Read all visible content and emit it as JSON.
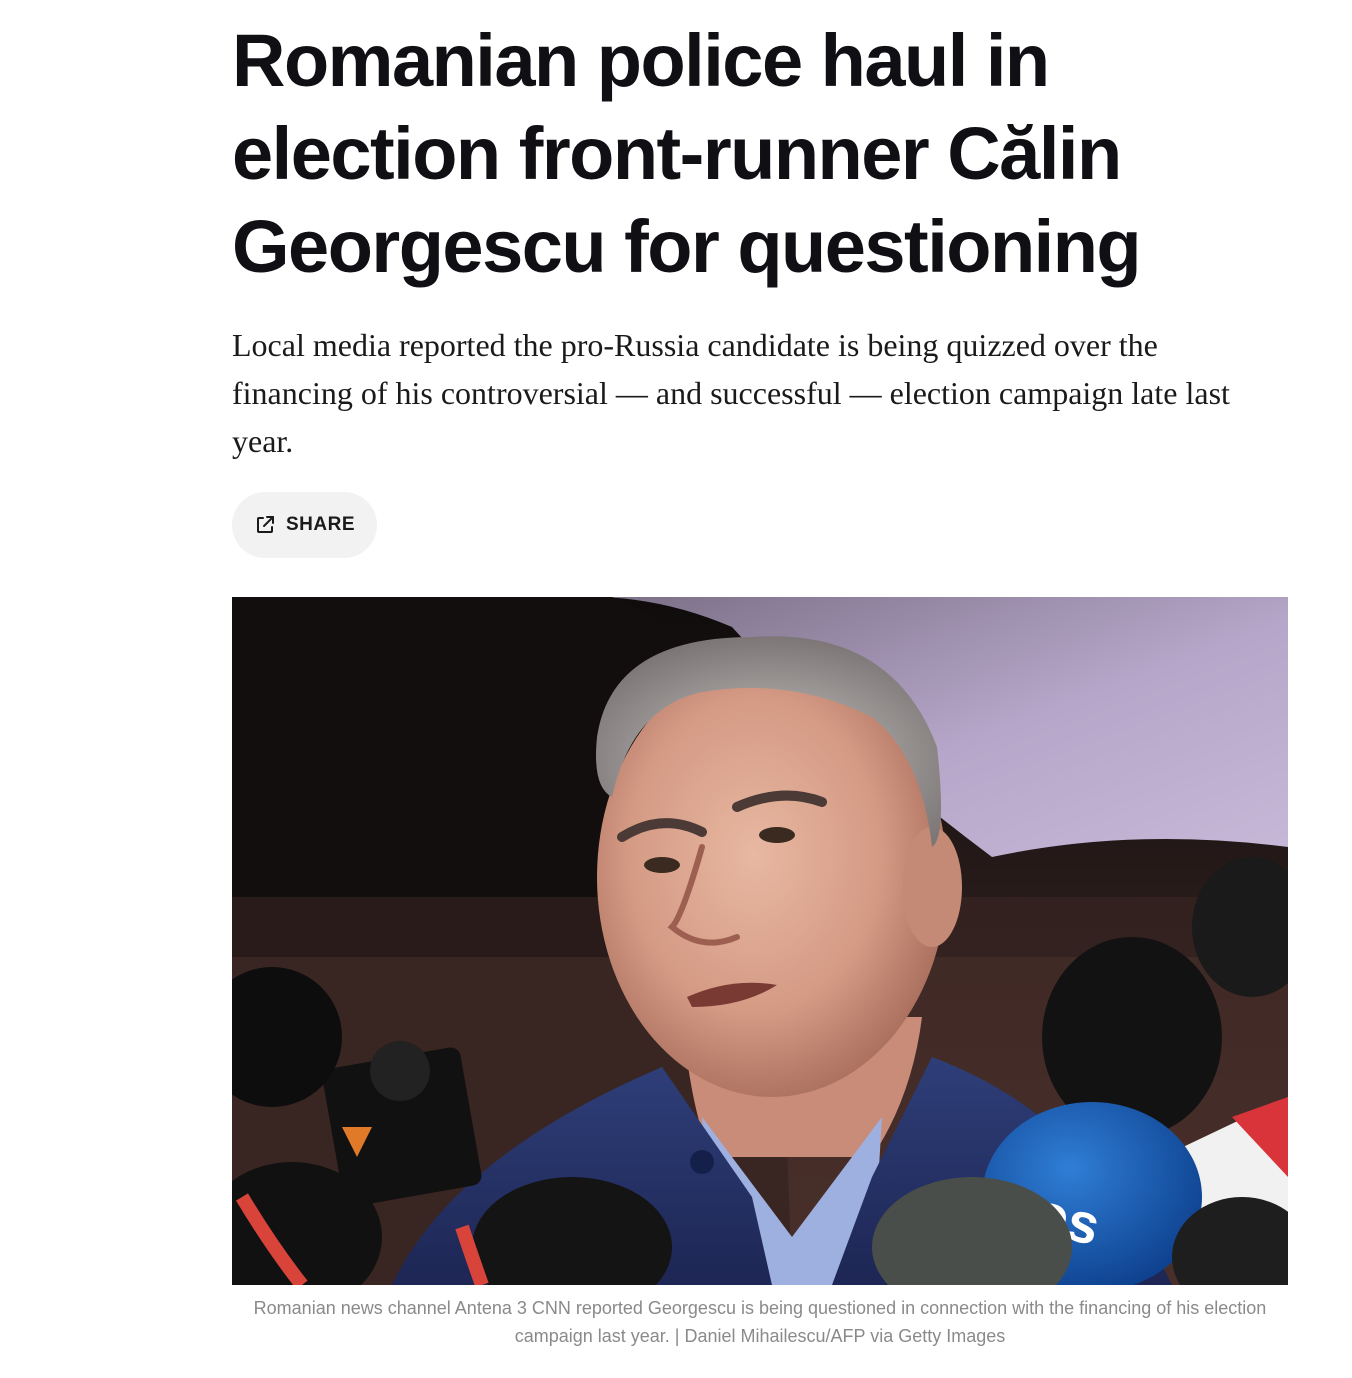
{
  "article": {
    "headline": "Romanian police haul in election front-runner Călin Georgescu for questioning",
    "dek": "Local media reported the pro-Russia candidate is being quizzed over the financing of his controversial — and successful — election campaign late last year.",
    "share": {
      "label": "SHARE",
      "icon": "share-external-icon"
    },
    "hero_image": {
      "alt": "Călin Georgescu speaking to reporters in front of microphones",
      "caption": "Romanian news channel Antena 3 CNN reported Georgescu is being questioned in connection with the financing of his election campaign last year.",
      "credit": "Daniel Mihailescu/AFP via Getty Images",
      "separator": " | "
    }
  },
  "colors": {
    "headline": "#0f0f14",
    "dek": "#1a1a1a",
    "share_bg": "#f2f2f2",
    "caption": "#8a8a8a"
  }
}
